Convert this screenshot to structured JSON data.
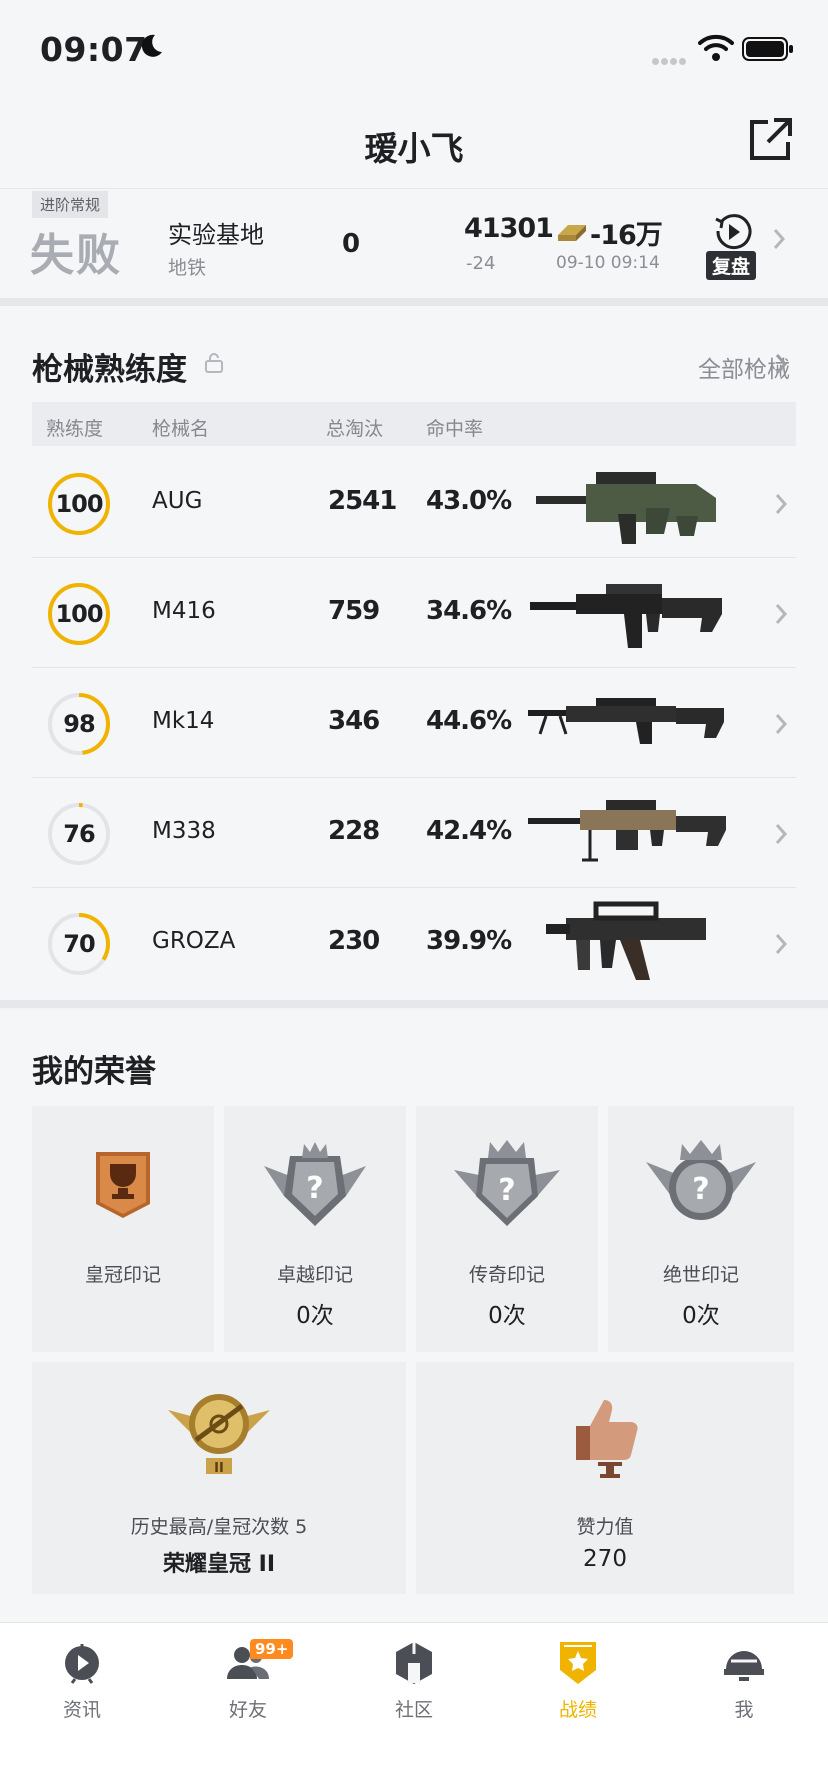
{
  "status_bar": {
    "time": "09:07"
  },
  "header": {
    "title": "瑷小飞"
  },
  "last_match": {
    "mode": "进阶常规",
    "result": "失败",
    "map": "实验基地",
    "submode": "地铁",
    "kills": "0",
    "score": "41301",
    "score_delta": "-24",
    "coins": "-16万",
    "datetime": "09-10 09:14",
    "replay_label": "复盘"
  },
  "weapons": {
    "title": "枪械熟练度",
    "all_link": "全部枪械",
    "columns": [
      "熟练度",
      "枪械名",
      "总淘汰",
      "命中率"
    ],
    "rows": [
      {
        "proficiency": "100",
        "level": 1.0,
        "name": "AUG",
        "kills": "2541",
        "accuracy": "43.0%"
      },
      {
        "proficiency": "100",
        "level": 1.0,
        "name": "M416",
        "kills": "759",
        "accuracy": "34.6%"
      },
      {
        "proficiency": "98",
        "level": 0.48,
        "name": "Mk14",
        "kills": "346",
        "accuracy": "44.6%"
      },
      {
        "proficiency": "76",
        "level": 0.02,
        "name": "M338",
        "kills": "228",
        "accuracy": "42.4%"
      },
      {
        "proficiency": "70",
        "level": 0.34,
        "name": "GROZA",
        "kills": "230",
        "accuracy": "39.9%"
      }
    ]
  },
  "honors": {
    "title": "我的荣誉",
    "marks": [
      {
        "label": "皇冠印记",
        "count": ""
      },
      {
        "label": "卓越印记",
        "count": "0次"
      },
      {
        "label": "传奇印记",
        "count": "0次"
      },
      {
        "label": "绝世印记",
        "count": "0次"
      }
    ],
    "rank": {
      "caption": "历史最高/皇冠次数 5",
      "value": "荣耀皇冠 II"
    },
    "likes": {
      "caption": "赞力值",
      "value": "270"
    }
  },
  "tabs": [
    {
      "label": "资讯",
      "icon": "news-icon"
    },
    {
      "label": "好友",
      "icon": "friends-icon",
      "badge": "99+"
    },
    {
      "label": "社区",
      "icon": "community-icon"
    },
    {
      "label": "战绩",
      "icon": "record-icon",
      "active": true
    },
    {
      "label": "我",
      "icon": "profile-icon"
    }
  ],
  "colors": {
    "accent": "#f0b400",
    "text": "#1f2023",
    "muted": "#8b8e95"
  }
}
